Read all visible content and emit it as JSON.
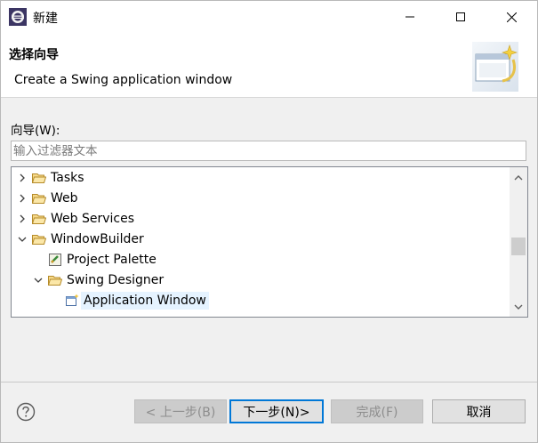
{
  "window": {
    "title": "新建",
    "app_icon": "eclipse-icon",
    "controls": [
      "minimize-icon",
      "maximize-icon",
      "close-icon"
    ]
  },
  "header": {
    "title": "选择向导",
    "description": "Create a Swing application window",
    "banner_icon": "new-window-wizard-icon"
  },
  "wizards": {
    "label": "向导(W):",
    "filter_placeholder": "输入过滤器文本",
    "tree": [
      {
        "label": "Tasks",
        "expanded": false,
        "icon": "folder-icon"
      },
      {
        "label": "Web",
        "expanded": false,
        "icon": "folder-icon"
      },
      {
        "label": "Web Services",
        "expanded": false,
        "icon": "folder-icon"
      },
      {
        "label": "WindowBuilder",
        "expanded": true,
        "icon": "folder-icon"
      },
      {
        "label": "Project Palette",
        "icon": "palette-icon"
      },
      {
        "label": "Swing Designer",
        "expanded": true,
        "icon": "folder-icon"
      },
      {
        "label": "Application Window",
        "selected": true,
        "icon": "application-window-icon"
      }
    ],
    "scroll_position": 0.55
  },
  "buttons": {
    "back": "< 上一步(B)",
    "next": "下一步(N)>",
    "finish": "完成(F)",
    "cancel": "取消"
  },
  "colors": {
    "primary_border": "#0078d7",
    "selection": "#e5f3ff",
    "folder": "#e8b84a"
  }
}
